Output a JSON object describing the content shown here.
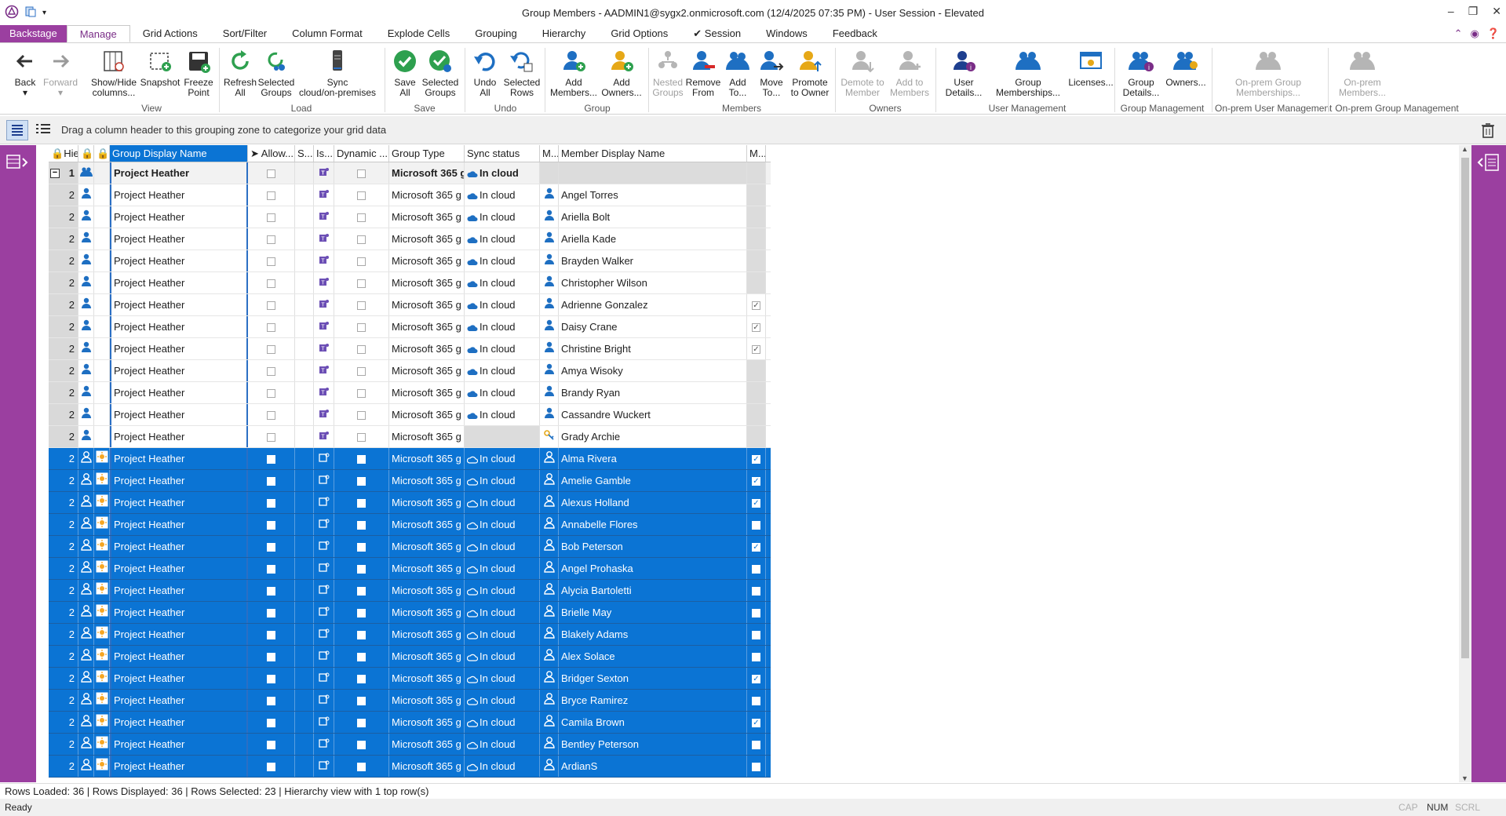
{
  "window": {
    "title": "Group Members - AADMIN1@sygx2.onmicrosoft.com (12/4/2025 07:35 PM) - User Session - Elevated",
    "controls": [
      "–",
      "❐",
      "✕"
    ]
  },
  "tabs": [
    "Backstage",
    "Manage",
    "Grid Actions",
    "Sort/Filter",
    "Column Format",
    "Explode Cells",
    "Grouping",
    "Hierarchy",
    "Grid Options",
    "✔ Session",
    "Windows",
    "Feedback"
  ],
  "active_tab": "Manage",
  "ribbon": {
    "buttons": [
      {
        "l1": "Back",
        "l2": "▾",
        "icon": "back-arrow-icon"
      },
      {
        "l1": "Forward",
        "l2": "▾",
        "icon": "forward-arrow-icon"
      },
      {
        "l1": "Show/Hide",
        "l2": "columns...",
        "icon": "columns-icon"
      },
      {
        "l1": "Snapshot",
        "l2": "",
        "icon": "snapshot-icon"
      },
      {
        "l1": "Freeze",
        "l2": "Point",
        "icon": "save-disk-icon"
      },
      {
        "l1": "Refresh",
        "l2": "All",
        "icon": "refresh-icon"
      },
      {
        "l1": "Selected",
        "l2": "Groups",
        "icon": "refresh-groups-icon"
      },
      {
        "l1": "Sync",
        "l2": "cloud/on-premises",
        "icon": "sync-icon"
      },
      {
        "l1": "Save",
        "l2": "All",
        "icon": "check-circle-icon"
      },
      {
        "l1": "Selected",
        "l2": "Groups",
        "icon": "check-circle-multi-icon"
      },
      {
        "l1": "Undo",
        "l2": "All",
        "icon": "undo-icon"
      },
      {
        "l1": "Selected",
        "l2": "Rows",
        "icon": "undo-rows-icon"
      },
      {
        "l1": "Add",
        "l2": "Members...",
        "icon": "add-member-icon"
      },
      {
        "l1": "Add",
        "l2": "Owners...",
        "icon": "add-owner-icon"
      },
      {
        "l1": "Nested",
        "l2": "Groups",
        "icon": "nested-groups-icon"
      },
      {
        "l1": "Remove",
        "l2": "From",
        "icon": "remove-user-icon"
      },
      {
        "l1": "Add",
        "l2": "To...",
        "icon": "add-to-icon"
      },
      {
        "l1": "Move",
        "l2": "To...",
        "icon": "move-user-icon"
      },
      {
        "l1": "Promote",
        "l2": "to Owner",
        "icon": "promote-icon"
      },
      {
        "l1": "Demote to",
        "l2": "Member",
        "icon": "demote-icon"
      },
      {
        "l1": "Add to",
        "l2": "Members",
        "icon": "add-to-members-icon"
      },
      {
        "l1": "User",
        "l2": "Details...",
        "icon": "user-details-icon"
      },
      {
        "l1": "Group",
        "l2": "Memberships...",
        "icon": "group-memberships-icon"
      },
      {
        "l1": "Licenses...",
        "l2": "",
        "icon": "licenses-icon"
      },
      {
        "l1": "Group",
        "l2": "Details...",
        "icon": "group-details-icon"
      },
      {
        "l1": "Owners...",
        "l2": "",
        "icon": "owners-icon"
      },
      {
        "l1": "On-prem Group",
        "l2": "Memberships...",
        "icon": "onprem-memberships-icon"
      },
      {
        "l1": "On-prem",
        "l2": "Members...",
        "icon": "onprem-members-icon"
      }
    ],
    "groups": [
      "View",
      "Load",
      "Save",
      "Undo",
      "Group",
      "Members",
      "Owners",
      "User Management",
      "Group Management",
      "On-prem User Management",
      "On-prem Group Management"
    ]
  },
  "groupzone": {
    "text": "Drag a column header to this grouping zone to categorize your grid data"
  },
  "columns": [
    "Hie...",
    "",
    "",
    "Group Display Name",
    "Allow...",
    "S...",
    "Is...",
    "Dynamic ...",
    "Group Type",
    "Sync status",
    "M...",
    "Member Display Name",
    "M..."
  ],
  "rows": [
    {
      "lvl": "1",
      "name": "Project Heather",
      "type": "Microsoft 365 g",
      "sync": "In cloud",
      "member": "",
      "m": "none",
      "top": true,
      "sel": false,
      "kind": "group"
    },
    {
      "lvl": "2",
      "name": "Project Heather",
      "type": "Microsoft 365 g",
      "sync": "In cloud",
      "member": "Angel Torres",
      "m": "grey",
      "sel": false,
      "kind": "user"
    },
    {
      "lvl": "2",
      "name": "Project Heather",
      "type": "Microsoft 365 g",
      "sync": "In cloud",
      "member": "Ariella Bolt",
      "m": "grey",
      "sel": false,
      "kind": "user"
    },
    {
      "lvl": "2",
      "name": "Project Heather",
      "type": "Microsoft 365 g",
      "sync": "In cloud",
      "member": "Ariella Kade",
      "m": "grey",
      "sel": false,
      "kind": "user"
    },
    {
      "lvl": "2",
      "name": "Project Heather",
      "type": "Microsoft 365 g",
      "sync": "In cloud",
      "member": "Brayden Walker",
      "m": "grey",
      "sel": false,
      "kind": "user"
    },
    {
      "lvl": "2",
      "name": "Project Heather",
      "type": "Microsoft 365 g",
      "sync": "In cloud",
      "member": "Christopher Wilson",
      "m": "grey",
      "sel": false,
      "kind": "user"
    },
    {
      "lvl": "2",
      "name": "Project Heather",
      "type": "Microsoft 365 g",
      "sync": "In cloud",
      "member": "Adrienne Gonzalez",
      "m": "on",
      "sel": false,
      "kind": "user"
    },
    {
      "lvl": "2",
      "name": "Project Heather",
      "type": "Microsoft 365 g",
      "sync": "In cloud",
      "member": "Daisy Crane",
      "m": "on",
      "sel": false,
      "kind": "user"
    },
    {
      "lvl": "2",
      "name": "Project Heather",
      "type": "Microsoft 365 g",
      "sync": "In cloud",
      "member": "Christine Bright",
      "m": "on",
      "sel": false,
      "kind": "user"
    },
    {
      "lvl": "2",
      "name": "Project Heather",
      "type": "Microsoft 365 g",
      "sync": "In cloud",
      "member": "Amya Wisoky",
      "m": "grey",
      "sel": false,
      "kind": "user"
    },
    {
      "lvl": "2",
      "name": "Project Heather",
      "type": "Microsoft 365 g",
      "sync": "In cloud",
      "member": "Brandy Ryan",
      "m": "grey",
      "sel": false,
      "kind": "user"
    },
    {
      "lvl": "2",
      "name": "Project Heather",
      "type": "Microsoft 365 g",
      "sync": "In cloud",
      "member": "Cassandre Wuckert",
      "m": "grey",
      "sel": false,
      "kind": "user"
    },
    {
      "lvl": "2",
      "name": "Project Heather",
      "type": "Microsoft 365 g",
      "sync": "",
      "member": "Grady Archie",
      "m": "grey",
      "sel": false,
      "kind": "user",
      "special": true
    },
    {
      "lvl": "2",
      "name": "Project Heather",
      "type": "Microsoft 365 g",
      "sync": "In cloud",
      "member": "Alma Rivera",
      "m": "on",
      "sel": true,
      "kind": "user"
    },
    {
      "lvl": "2",
      "name": "Project Heather",
      "type": "Microsoft 365 g",
      "sync": "In cloud",
      "member": "Amelie Gamble",
      "m": "on",
      "sel": true,
      "kind": "user"
    },
    {
      "lvl": "2",
      "name": "Project Heather",
      "type": "Microsoft 365 g",
      "sync": "In cloud",
      "member": "Alexus Holland",
      "m": "on",
      "sel": true,
      "kind": "user"
    },
    {
      "lvl": "2",
      "name": "Project Heather",
      "type": "Microsoft 365 g",
      "sync": "In cloud",
      "member": "Annabelle Flores",
      "m": "off",
      "sel": true,
      "kind": "user"
    },
    {
      "lvl": "2",
      "name": "Project Heather",
      "type": "Microsoft 365 g",
      "sync": "In cloud",
      "member": "Bob Peterson",
      "m": "on",
      "sel": true,
      "kind": "user"
    },
    {
      "lvl": "2",
      "name": "Project Heather",
      "type": "Microsoft 365 g",
      "sync": "In cloud",
      "member": "Angel Prohaska",
      "m": "off",
      "sel": true,
      "kind": "user"
    },
    {
      "lvl": "2",
      "name": "Project Heather",
      "type": "Microsoft 365 g",
      "sync": "In cloud",
      "member": "Alycia Bartoletti",
      "m": "off",
      "sel": true,
      "kind": "user"
    },
    {
      "lvl": "2",
      "name": "Project Heather",
      "type": "Microsoft 365 g",
      "sync": "In cloud",
      "member": "Brielle May",
      "m": "off",
      "sel": true,
      "kind": "user"
    },
    {
      "lvl": "2",
      "name": "Project Heather",
      "type": "Microsoft 365 g",
      "sync": "In cloud",
      "member": "Blakely Adams",
      "m": "off",
      "sel": true,
      "kind": "user"
    },
    {
      "lvl": "2",
      "name": "Project Heather",
      "type": "Microsoft 365 g",
      "sync": "In cloud",
      "member": "Alex Solace",
      "m": "off",
      "sel": true,
      "kind": "user"
    },
    {
      "lvl": "2",
      "name": "Project Heather",
      "type": "Microsoft 365 g",
      "sync": "In cloud",
      "member": "Bridger Sexton",
      "m": "on",
      "sel": true,
      "kind": "user"
    },
    {
      "lvl": "2",
      "name": "Project Heather",
      "type": "Microsoft 365 g",
      "sync": "In cloud",
      "member": "Bryce Ramirez",
      "m": "off",
      "sel": true,
      "kind": "user"
    },
    {
      "lvl": "2",
      "name": "Project Heather",
      "type": "Microsoft 365 g",
      "sync": "In cloud",
      "member": "Camila Brown",
      "m": "on",
      "sel": true,
      "kind": "user"
    },
    {
      "lvl": "2",
      "name": "Project Heather",
      "type": "Microsoft 365 g",
      "sync": "In cloud",
      "member": "Bentley Peterson",
      "m": "off",
      "sel": true,
      "kind": "user"
    },
    {
      "lvl": "2",
      "name": "Project Heather",
      "type": "Microsoft 365 g",
      "sync": "In cloud",
      "member": "ArdianS",
      "m": "off",
      "sel": true,
      "kind": "user"
    }
  ],
  "status": {
    "line1": "Rows Loaded: 36 | Rows Displayed: 36 | Rows Selected: 23 | Hierarchy view with 1 top row(s)",
    "line2": "Ready",
    "cap": "CAP",
    "num": "NUM",
    "scrl": "SCRL"
  },
  "colors": {
    "accent": "#9b3fa0",
    "selection": "#0b74d4",
    "icon_blue": "#1e6fc2"
  }
}
